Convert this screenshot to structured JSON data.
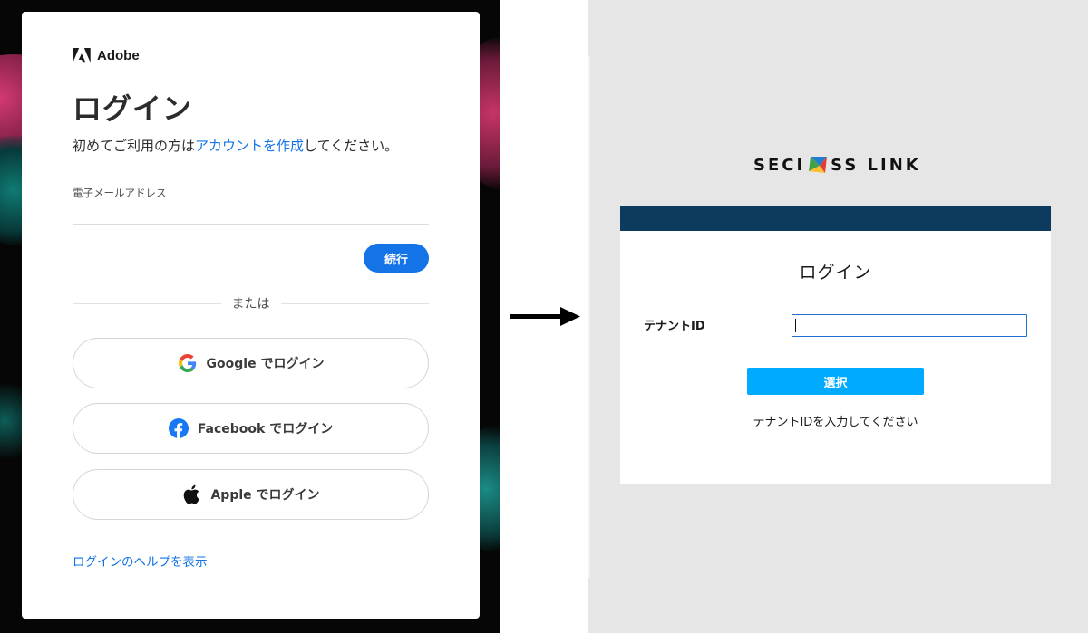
{
  "adobe": {
    "brand": "Adobe",
    "title": "ログイン",
    "subtitle_prefix": "初めてご利用の方は",
    "subtitle_link": "アカウントを作成",
    "subtitle_suffix": "してください。",
    "email_label": "電子メールアドレス",
    "email_value": "",
    "continue_label": "続行",
    "or_label": "または",
    "google_brand": "Google",
    "google_suffix": " でログイン",
    "facebook_brand": "Facebook",
    "facebook_suffix": " でログイン",
    "apple_brand": "Apple",
    "apple_suffix": " でログイン",
    "help_link": "ログインのヘルプを表示",
    "colors": {
      "accent": "#1473e6",
      "text": "#2c2c2c"
    }
  },
  "seciss": {
    "logo_left": "SECI",
    "logo_right": "SS LINK",
    "title": "ログイン",
    "tenant_label": "テナントID",
    "tenant_value": "",
    "select_label": "選択",
    "hint": "テナントIDを入力してください",
    "colors": {
      "bar": "#0c3b5e",
      "button": "#00aaff",
      "input_border": "#1f6fd1"
    }
  },
  "icons": [
    "adobe-logo-icon",
    "google-icon",
    "facebook-icon",
    "apple-icon",
    "arrow-right-icon",
    "seciss-logo-mark-icon"
  ]
}
